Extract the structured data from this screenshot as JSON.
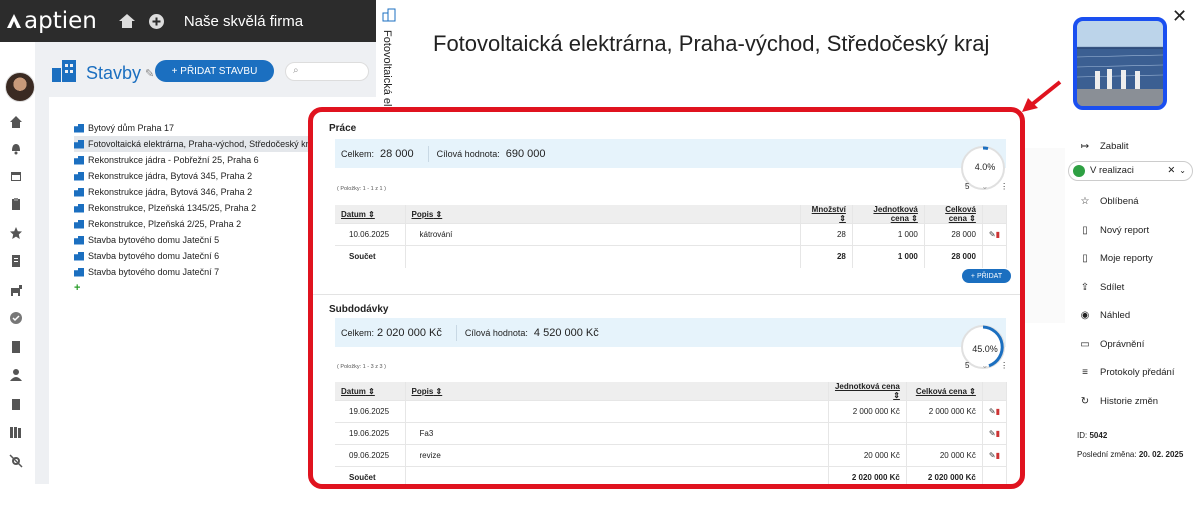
{
  "topbar": {
    "logo": "aptien",
    "company": "Naše skvělá firma"
  },
  "workspace": {
    "title": "Stavby",
    "add_button": "+ PŘIDAT STAVBU",
    "search_placeholder": ""
  },
  "tree": {
    "items": [
      "Bytový dům Praha 17",
      "Fotovoltaická elektrárna, Praha-východ, Středočeský kraj",
      "Rekonstrukce jádra - Pobřežní 25, Praha 6",
      "Rekonstrukce jádra, Bytová 345, Praha 2",
      "Rekonstrukce jádra, Bytová 346, Praha 2",
      "Rekonstrukce, Plzeňská 1345/25, Praha 2",
      "Rekonstrukce, Plzeňská 2/25, Praha 2",
      "Stavba bytového domu Jateční 5",
      "Stavba bytového domu Jateční 6",
      "Stavba bytového domu Jateční 7"
    ],
    "add": "+"
  },
  "detail": {
    "vertical_title": "Fotovoltaická el",
    "title": "Fotovoltaická elektrárna, Praha-východ, Středočeský kraj"
  },
  "prace": {
    "heading": "Práce",
    "celkem_label": "Celkem:",
    "celkem_value": "28 000",
    "cil_label": "Cílová hodnota:",
    "cil_value": "690 000",
    "pct": "4.0%",
    "pocet": "( Položky: 1 - 1 z 1 )",
    "page_size": "5",
    "cols": [
      "Datum",
      "Popis",
      "Množství",
      "Jednotková cena",
      "Celková cena"
    ],
    "rows": [
      {
        "datum": "10.06.2025",
        "popis": "kátrování",
        "mnozstvi": "28",
        "jedn": "1 000",
        "celk": "28 000"
      }
    ],
    "sum": {
      "label": "Součet",
      "mnozstvi": "28",
      "jedn": "1 000",
      "celk": "28 000"
    },
    "add_button": "+ PŘIDAT"
  },
  "subdodavky": {
    "heading": "Subdodávky",
    "celkem_label": "Celkem:",
    "celkem_value": "2 020 000 Kč",
    "cil_label": "Cílová hodnota:",
    "cil_value": "4 520 000 Kč",
    "pct": "45.0%",
    "pocet": "( Položky: 1 - 3 z 3 )",
    "page_size": "5",
    "cols": [
      "Datum",
      "Popis",
      "Jednotková cena",
      "Celková cena"
    ],
    "rows": [
      {
        "datum": "19.06.2025",
        "popis": "",
        "jedn": "2 000 000 Kč",
        "celk": "2 000 000 Kč"
      },
      {
        "datum": "19.06.2025",
        "popis": "Fa3",
        "jedn": "",
        "celk": ""
      },
      {
        "datum": "09.06.2025",
        "popis": "revize",
        "jedn": "20 000 Kč",
        "celk": "20 000 Kč"
      }
    ],
    "sum": {
      "label": "Součet",
      "jedn": "2 020 000 Kč",
      "celk": "2 020 000 Kč"
    }
  },
  "right": {
    "zabalit": "Zabalit",
    "status": "V realizaci",
    "status_color": "#2ea043",
    "items": [
      "Oblíbená",
      "Nový report",
      "Moje reporty",
      "Sdílet",
      "Náhled",
      "Oprávnění",
      "Protokoly předání",
      "Historie změn"
    ],
    "id_label": "ID:",
    "id_value": "5042",
    "zmena_label": "Poslední změna:",
    "zmena_value": "20. 02. 2025"
  },
  "colors": {
    "accent": "#1b6fc0",
    "highlight": "#e0131f"
  }
}
